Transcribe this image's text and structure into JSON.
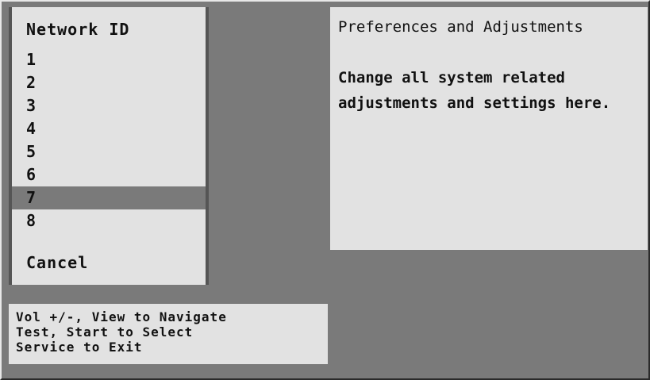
{
  "menu": {
    "title": "Network ID",
    "items": [
      {
        "label": "1",
        "selected": false
      },
      {
        "label": "2",
        "selected": false
      },
      {
        "label": "3",
        "selected": false
      },
      {
        "label": "4",
        "selected": false
      },
      {
        "label": "5",
        "selected": false
      },
      {
        "label": "6",
        "selected": false
      },
      {
        "label": "7",
        "selected": true
      },
      {
        "label": "8",
        "selected": false
      }
    ],
    "cancel_label": "Cancel"
  },
  "info": {
    "title": "Preferences and Adjustments",
    "description": "Change all system related adjustments and settings here."
  },
  "help": {
    "lines": [
      "Vol +/-, View to Navigate",
      "Test, Start to Select",
      "Service to Exit"
    ]
  },
  "colors": {
    "background": "#7a7a7a",
    "panel": "#e2e2e2",
    "highlight": "#7a7a7a",
    "text": "#111111"
  }
}
